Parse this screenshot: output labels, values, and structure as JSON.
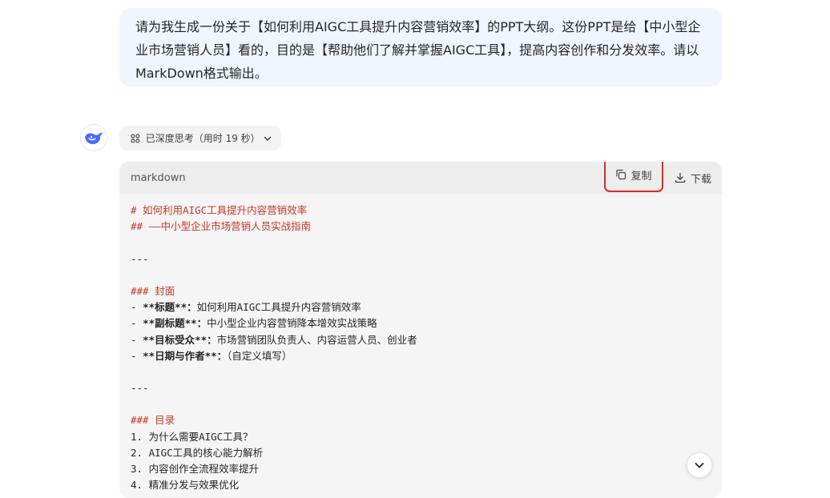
{
  "user_message": {
    "text": "请为我生成一份关于【如何利用AIGC工具提升内容营销效率】的PPT大纲。这份PPT是给【中小型企业市场营销人员】看的，目的是【帮助他们了解并掌握AIGC工具】，提高内容创作和分发效率。请以MarkDown格式输出。"
  },
  "assistant": {
    "avatar_icon": "deepseek-whale-icon",
    "thinking_label": "已深度思考（用时 19 秒）",
    "code_block": {
      "language": "markdown",
      "copy_label": "复制",
      "download_label": "下载",
      "highlight_color": "#e02a1f",
      "heading_color": "#c0392b",
      "lines": [
        {
          "prefix": "# ",
          "text": "如何利用AIGC工具提升内容营销效率",
          "style": "heading"
        },
        {
          "prefix": "## ",
          "text": "——中小型企业市场营销人员实战指南",
          "style": "heading"
        },
        {
          "prefix": "",
          "text": "",
          "style": "plain"
        },
        {
          "prefix": "---",
          "text": "",
          "style": "plain"
        },
        {
          "prefix": "",
          "text": "",
          "style": "plain"
        },
        {
          "prefix": "### ",
          "text": "封面",
          "style": "heading"
        },
        {
          "prefix": "- ",
          "bold": "**标题**：",
          "text": "如何利用AIGC工具提升内容营销效率",
          "style": "item"
        },
        {
          "prefix": "- ",
          "bold": "**副标题**：",
          "text": "中小型企业内容营销降本增效实战策略",
          "style": "item"
        },
        {
          "prefix": "- ",
          "bold": "**目标受众**：",
          "text": "市场营销团队负责人、内容运营人员、创业者",
          "style": "item"
        },
        {
          "prefix": "- ",
          "bold": "**日期与作者**：",
          "text": "（自定义填写）",
          "style": "item"
        },
        {
          "prefix": "",
          "text": "",
          "style": "plain"
        },
        {
          "prefix": "---",
          "text": "",
          "style": "plain"
        },
        {
          "prefix": "",
          "text": "",
          "style": "plain"
        },
        {
          "prefix": "### ",
          "text": "目录",
          "style": "heading"
        },
        {
          "prefix": "1. ",
          "text": "为什么需要AIGC工具？",
          "style": "plain"
        },
        {
          "prefix": "2. ",
          "text": "AIGC工具的核心能力解析",
          "style": "plain"
        },
        {
          "prefix": "3. ",
          "text": "内容创作全流程效率提升",
          "style": "plain"
        },
        {
          "prefix": "4. ",
          "text": "精准分发与效果优化",
          "style": "plain"
        }
      ]
    }
  },
  "scroll_button_icon": "chevron-down-icon"
}
